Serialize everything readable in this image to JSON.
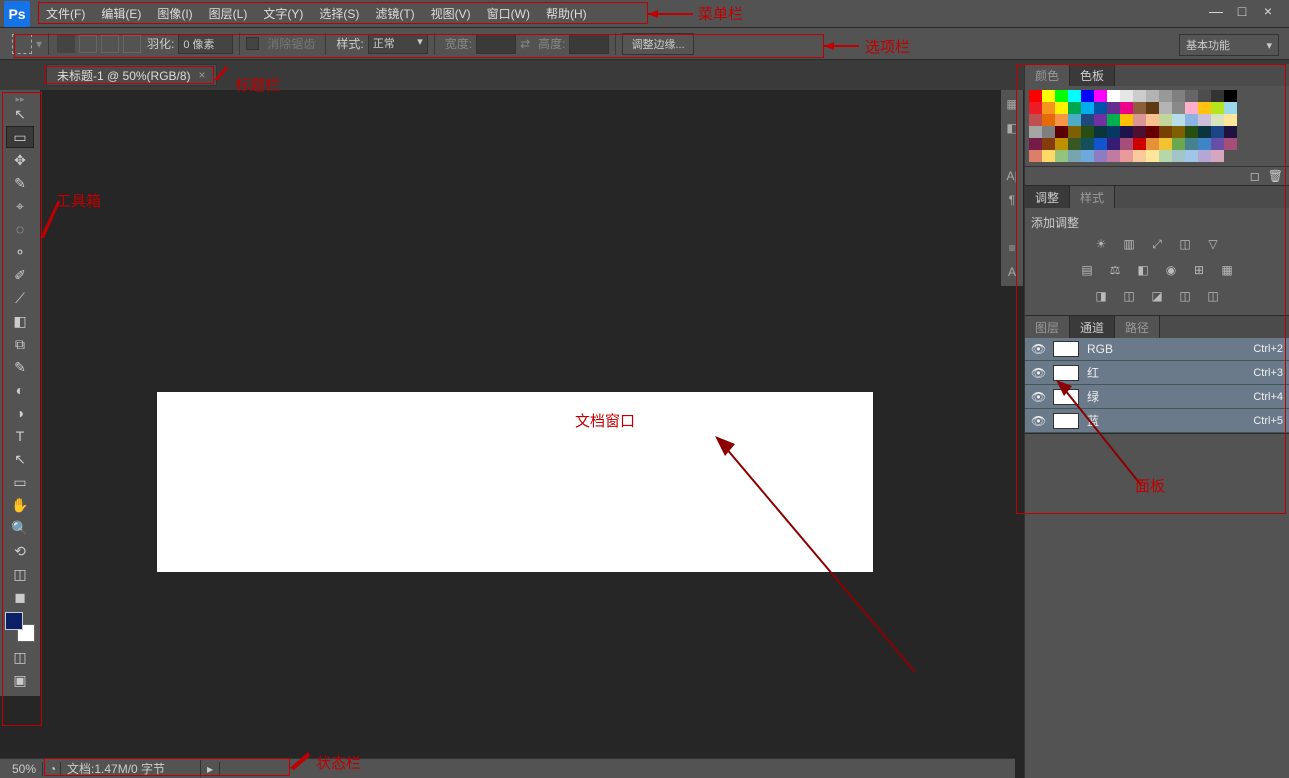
{
  "logo": "Ps",
  "menu": [
    "文件(F)",
    "编辑(E)",
    "图像(I)",
    "图层(L)",
    "文字(Y)",
    "选择(S)",
    "滤镜(T)",
    "视图(V)",
    "窗口(W)",
    "帮助(H)"
  ],
  "win": {
    "min": "—",
    "max": "□",
    "close": "×"
  },
  "options": {
    "feather_label": "羽化:",
    "feather_value": "0 像素",
    "antialias": "消除锯齿",
    "style_label": "样式:",
    "style_value": "正常",
    "width_label": "宽度:",
    "swap": "⇄",
    "height_label": "高度:",
    "refine_btn": "调整边缘..."
  },
  "workspace_dd": "基本功能",
  "doc_tab": "未标题-1 @ 50%(RGB/8)",
  "annotations": {
    "menubar": "菜单栏",
    "optionbar": "选项栏",
    "titlebar": "标题栏",
    "toolbox": "工具箱",
    "docwin": "文档窗口",
    "statusbar": "状态栏",
    "panel": "面板"
  },
  "tools": [
    "↖",
    "▭",
    "✥",
    "✎",
    "⌖",
    "◌",
    "⚬",
    "✐",
    "⟋",
    "◧",
    "⧉",
    "✎",
    "◐",
    "◑",
    "T",
    "↖",
    "▭",
    "✋",
    "🔍",
    "⟲",
    "◫",
    "◼"
  ],
  "panels": {
    "swatch_tabs": [
      "颜色",
      "色板"
    ],
    "adjust_tabs": [
      "调整",
      "样式"
    ],
    "adjust_title": "添加调整",
    "layer_tabs": [
      "图层",
      "通道",
      "路径"
    ],
    "channels": [
      {
        "name": "RGB",
        "sc": "Ctrl+2"
      },
      {
        "name": "红",
        "sc": "Ctrl+3"
      },
      {
        "name": "绿",
        "sc": "Ctrl+4"
      },
      {
        "name": "蓝",
        "sc": "Ctrl+5"
      }
    ]
  },
  "swatch_colors": [
    "#ff0000",
    "#ffff00",
    "#00ff00",
    "#00ffff",
    "#0000ff",
    "#ff00ff",
    "#ffffff",
    "#e6e6e6",
    "#cccccc",
    "#b3b3b3",
    "#999999",
    "#808080",
    "#666666",
    "#4d4d4d",
    "#333333",
    "#000000",
    "#ec1c24",
    "#f7941e",
    "#fff100",
    "#00a550",
    "#00aeef",
    "#0054a5",
    "#652d90",
    "#ed008c",
    "#8b5e3c",
    "#603913",
    "#b4b4b4",
    "#898989",
    "#ffaec9",
    "#ffc20e",
    "#b5e61d",
    "#99d9ea",
    "#c0504d",
    "#e36c09",
    "#f79646",
    "#4bacc6",
    "#1f497d",
    "#7030a0",
    "#00b050",
    "#ffc000",
    "#d99694",
    "#fac090",
    "#c2d69b",
    "#b6dde8",
    "#8db3e2",
    "#ccc0d9",
    "#d7e4bd",
    "#ffe599",
    "#a5a5a5",
    "#7f7f7f",
    "#590000",
    "#7f6000",
    "#274e13",
    "#0c343d",
    "#073763",
    "#20124d",
    "#4c1130",
    "#660000",
    "#783f04",
    "#7f6000",
    "#274e13",
    "#0c343d",
    "#1c4587",
    "#201240",
    "#741b47",
    "#843c0c",
    "#bf9000",
    "#385723",
    "#134f5c",
    "#1155cc",
    "#351c75",
    "#a64d79",
    "#cc0000",
    "#e69138",
    "#f1c232",
    "#6aa84f",
    "#45818e",
    "#3d85c6",
    "#674ea7",
    "#a64d79",
    "#dd7e6b",
    "#ffd966",
    "#93c47d",
    "#76a5af",
    "#6fa8dc",
    "#8e7cc3",
    "#c27ba0",
    "#ea9999",
    "#f9cb9c",
    "#ffe599",
    "#b6d7a8",
    "#a2c4c9",
    "#9fc5e8",
    "#b4a7d6",
    "#d5a6bd"
  ],
  "status": {
    "zoom": "50%",
    "doc": "文档:1.47M/0 字节"
  }
}
